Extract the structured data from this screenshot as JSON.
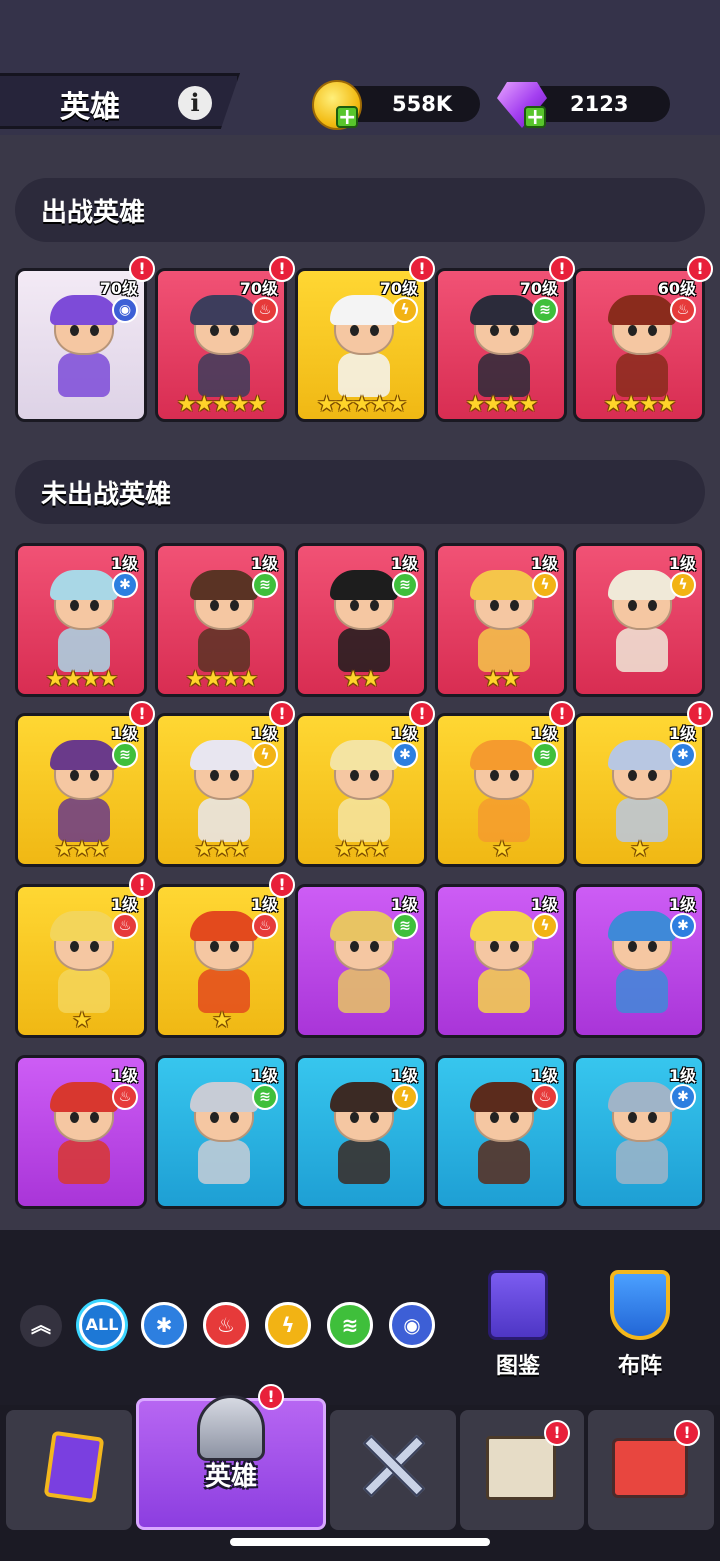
{
  "header": {
    "title": "英雄",
    "info_icon": "info-icon",
    "coins": {
      "value": "558K",
      "icon": "gold-coin-icon"
    },
    "gems": {
      "value": "2123",
      "icon": "purple-gem-icon"
    }
  },
  "sections": {
    "deployed": "出战英雄",
    "undeployed": "未出战英雄"
  },
  "deployed_heroes": [
    {
      "level": "70级",
      "element": "spirit",
      "stars": "",
      "color": "white",
      "alert": true
    },
    {
      "level": "70级",
      "element": "fire",
      "stars": "★★★★★",
      "color": "red",
      "alert": true
    },
    {
      "level": "70级",
      "element": "thunder",
      "stars": "★★★★★",
      "color": "yellow",
      "alert": true
    },
    {
      "level": "70级",
      "element": "wind",
      "stars": "★★★★",
      "color": "red",
      "alert": true
    },
    {
      "level": "60级",
      "element": "fire",
      "stars": "★★★★",
      "color": "red",
      "alert": true
    }
  ],
  "undeployed_heroes": [
    {
      "level": "1级",
      "element": "ice",
      "stars": "★★★★",
      "color": "red",
      "alert": false
    },
    {
      "level": "1级",
      "element": "wind",
      "stars": "★★★★",
      "color": "red",
      "alert": false
    },
    {
      "level": "1级",
      "element": "wind",
      "stars": "★★",
      "color": "red",
      "alert": false
    },
    {
      "level": "1级",
      "element": "thunder",
      "stars": "★★",
      "color": "red",
      "alert": false
    },
    {
      "level": "1级",
      "element": "thunder",
      "stars": "",
      "color": "red",
      "alert": false
    },
    {
      "level": "1级",
      "element": "wind",
      "stars": "★★★",
      "color": "yellow",
      "alert": true
    },
    {
      "level": "1级",
      "element": "thunder",
      "stars": "★★★",
      "color": "yellow",
      "alert": true
    },
    {
      "level": "1级",
      "element": "ice",
      "stars": "★★★",
      "color": "yellow",
      "alert": true
    },
    {
      "level": "1级",
      "element": "wind",
      "stars": "★",
      "color": "yellow",
      "alert": true
    },
    {
      "level": "1级",
      "element": "ice",
      "stars": "★",
      "color": "yellow",
      "alert": true
    },
    {
      "level": "1级",
      "element": "fire",
      "stars": "★",
      "color": "yellow",
      "alert": true
    },
    {
      "level": "1级",
      "element": "fire",
      "stars": "★",
      "color": "yellow",
      "alert": true
    },
    {
      "level": "1级",
      "element": "wind",
      "stars": "",
      "color": "purple",
      "alert": false
    },
    {
      "level": "1级",
      "element": "thunder",
      "stars": "",
      "color": "purple",
      "alert": false
    },
    {
      "level": "1级",
      "element": "ice",
      "stars": "",
      "color": "purple",
      "alert": false
    },
    {
      "level": "1级",
      "element": "fire",
      "stars": "",
      "color": "purple",
      "alert": false
    },
    {
      "level": "1级",
      "element": "wind",
      "stars": "",
      "color": "blue",
      "alert": false
    },
    {
      "level": "1级",
      "element": "thunder",
      "stars": "",
      "color": "blue",
      "alert": false
    },
    {
      "level": "1级",
      "element": "fire",
      "stars": "",
      "color": "blue",
      "alert": false
    },
    {
      "level": "1级",
      "element": "ice",
      "stars": "",
      "color": "blue",
      "alert": false
    }
  ],
  "filters": {
    "collapse": "︽",
    "all_label": "ALL",
    "elements": [
      "ice",
      "fire",
      "thunder",
      "wind",
      "spirit"
    ]
  },
  "tools": [
    {
      "label": "图鉴",
      "icon": "codex-book-icon"
    },
    {
      "label": "布阵",
      "icon": "formation-shield-icon"
    }
  ],
  "nav": {
    "active_label": "英雄",
    "tabs": [
      "cards-icon",
      "heroes-helmet-icon",
      "battle-swords-icon",
      "castle-icon",
      "shop-icon"
    ]
  },
  "colors": {
    "red": "#e23c60",
    "yellow": "#f7c623",
    "purple": "#b845e2",
    "blue": "#27b0e0",
    "white": "#eadff0",
    "fire": "#e63a3a",
    "ice": "#2d7fe0",
    "thunder": "#f2b314",
    "wind": "#3fbf3b",
    "spirit": "#3d5fd6"
  }
}
